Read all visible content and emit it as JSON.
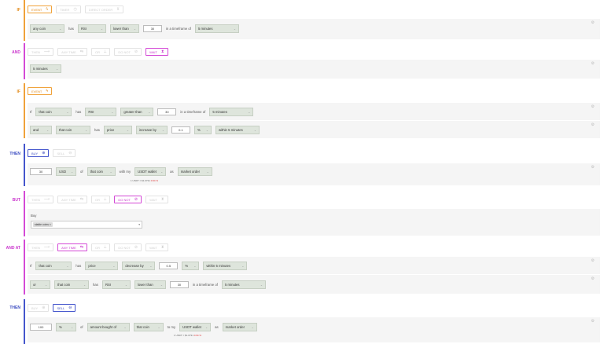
{
  "blocks": {
    "if1": {
      "keyword": "IF",
      "tabs": [
        "EVENT",
        "TIMER",
        "DIRECT ORDER"
      ],
      "row1": {
        "coin": "any coin",
        "has": "has",
        "indicator": "RSI",
        "comparison": "lower than",
        "value": "30",
        "timeframe_text": "in a timeframe of",
        "timeframe": "5 minutes"
      }
    },
    "and1": {
      "keyword": "AND",
      "tabs": [
        "THEN",
        "ANY TIME",
        "OR",
        "DO NOT",
        "WAIT"
      ],
      "row1": {
        "duration": "5 minutes"
      }
    },
    "if2": {
      "keyword": "IF",
      "tabs": [
        "EVENT"
      ],
      "row1": {
        "if_text": "If",
        "coin": "that coin",
        "has": "has",
        "indicator": "RSI",
        "comparison": "greater than",
        "value": "30",
        "timeframe_text": "in a timeframe of",
        "timeframe": "5 minutes"
      },
      "row2": {
        "conj": "and",
        "coin": "that coin",
        "has": "has",
        "metric": "price",
        "comparison": "increase by",
        "value": "0.1",
        "unit": "%",
        "within": "within 5 minutes"
      }
    },
    "then1": {
      "keyword": "THEN",
      "tabs": [
        "BUY",
        "SELL"
      ],
      "row1": {
        "amount": "30",
        "currency": "USD",
        "of_text": "of",
        "coin": "that coin",
        "with_text": "with my",
        "wallet": "USDT wallet",
        "as_text": "as",
        "order": "market order"
      },
      "note_prefix": "1 USDT = $1.0731",
      "note_change": "0.94 %"
    },
    "but1": {
      "keyword": "BUT",
      "tabs": [
        "THEN",
        "ANY TIME",
        "OR",
        "DO NOT",
        "WAIT"
      ],
      "label": "Buy",
      "chip": "stable coins ×"
    },
    "andat1": {
      "keyword": "AND AT",
      "tabs": [
        "THEN",
        "ANY TIME",
        "OR",
        "DO NOT",
        "WAIT"
      ],
      "row1": {
        "if_text": "If",
        "coin": "that coin",
        "has": "has",
        "metric": "price",
        "comparison": "decrease by",
        "value": "0.5",
        "unit": "%",
        "within": "within 5 minutes"
      },
      "row2": {
        "conj": "or",
        "coin": "that coin",
        "has": "has",
        "indicator": "RSI",
        "comparison": "lower than",
        "value": "30",
        "timeframe_text": "in a timeframe of",
        "timeframe": "5 minutes"
      }
    },
    "then2": {
      "keyword": "THEN",
      "tabs": [
        "BUY",
        "SELL"
      ],
      "row1": {
        "amount": "100",
        "unit": "%",
        "of_text": "of",
        "what": "amount bought of",
        "coin": "that coin",
        "to_text": "to my",
        "wallet": "USDT wallet",
        "as_text": "as",
        "order": "market order"
      },
      "note_prefix": "1 USDT = $1.0731",
      "note_change": "0.94 %"
    }
  },
  "colors": {
    "orange": "#f0a23a",
    "pink": "#d44ad6",
    "blue": "#4455cc",
    "panel": "#f5f5f5",
    "select": "#dee5dc"
  }
}
